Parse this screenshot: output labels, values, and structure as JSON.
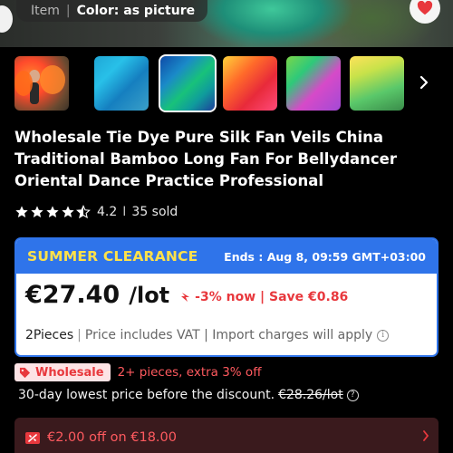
{
  "hero": {
    "item_label": "Item",
    "separator": "|",
    "color_label": "Color: as picture"
  },
  "thumbnails": [
    {
      "name": "thumb-1",
      "selected": false
    },
    {
      "name": "thumb-2",
      "selected": false
    },
    {
      "name": "thumb-3",
      "selected": true
    },
    {
      "name": "thumb-4",
      "selected": false
    },
    {
      "name": "thumb-5",
      "selected": false
    },
    {
      "name": "thumb-6",
      "selected": false
    }
  ],
  "product": {
    "title": "Wholesale Tie Dye Pure Silk Fan Veils China Traditional Bamboo Long Fan For Bellydancer Oriental Dance Practice Professional"
  },
  "rating": {
    "stars": 4.5,
    "score": "4.2",
    "separator": "I",
    "sold": "35 sold"
  },
  "sale": {
    "tag": "SUMMER CLEARANCE",
    "ends": "Ends :  Aug 8, 09:59 GMT+03:00",
    "price": "€27.40",
    "unit": "/lot",
    "discount": "-3% now | Save €0.86",
    "quantity": "2Pieces",
    "separator": "|",
    "vat_note": "Price includes VAT | Import charges will apply"
  },
  "wholesale": {
    "badge": "Wholesale",
    "text": "2+ pieces, extra 3% off"
  },
  "lowest_price": {
    "text": "30-day lowest price before the discount.",
    "old_price": "€28.26/lot"
  },
  "coupon": {
    "text": "€2.00 off on €18.00"
  },
  "colors": {
    "accent_blue": "#2f74ea",
    "sale_yellow": "#ffe14a",
    "discount_red": "#e8383d",
    "background": "#000000"
  }
}
